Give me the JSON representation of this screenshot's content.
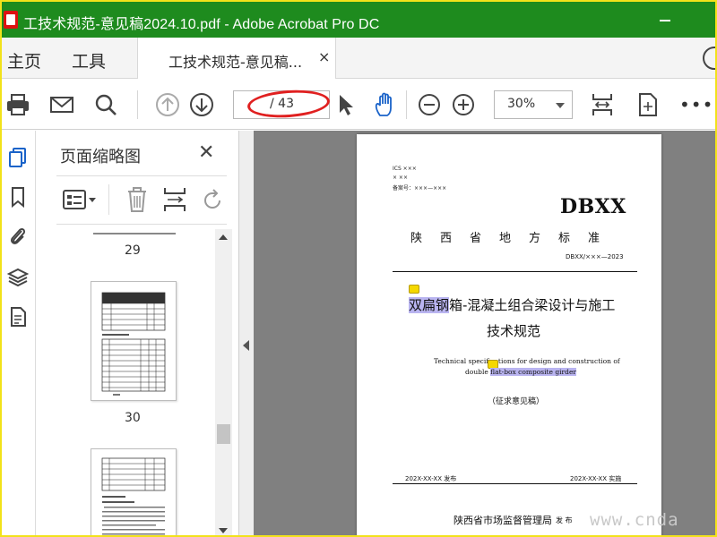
{
  "window": {
    "title": "工技术规范-意见稿2024.10.pdf - Adobe Acrobat Pro DC"
  },
  "nav": {
    "home": "主页",
    "tools": "工具"
  },
  "tab": {
    "label": "工技术规范-意见稿...",
    "close": "×"
  },
  "toolbar": {
    "page_total": "/ 43",
    "zoom": "30%",
    "more": "•••"
  },
  "thumbnails": {
    "header": "页面缩略图",
    "close": "✕",
    "pages": [
      "29",
      "30"
    ]
  },
  "document": {
    "ics": "ICS ×××",
    "class": "× ××",
    "record": "备案号：×××—×××",
    "dbxx": "DBXX",
    "standard_type": "陕西省地方标准",
    "code": "DBXX/×××—2023",
    "title_hl": "双扁钢",
    "title_rest": "箱-混凝土组合梁设计与施工",
    "title_line2": "技术规范",
    "en_line1": "Technical specifications for design and construction of",
    "en_line2_a": "double ",
    "en_line2_hl": "flat-box composite girder",
    "draft": "（征求意见稿）",
    "publish": "202X-XX-XX 发布",
    "implement": "202X-XX-XX 实施",
    "issuer": "陕西省市场监督管理局",
    "issue": "发 布"
  },
  "watermark": "www.cnda"
}
